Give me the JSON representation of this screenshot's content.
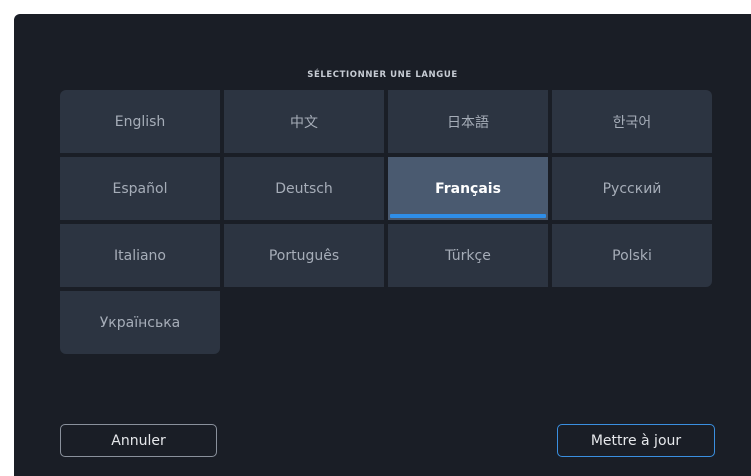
{
  "dialog": {
    "title": "SÉLECTIONNER UNE LANGUE",
    "languages": [
      "English",
      "中文",
      "日本語",
      "한국어",
      "Español",
      "Deutsch",
      "Français",
      "Русский",
      "Italiano",
      "Português",
      "Türkçe",
      "Polski",
      "Українська"
    ],
    "selected_language": "Français",
    "cancel_label": "Annuler",
    "update_label": "Mettre à jour"
  },
  "colors": {
    "background": "#1a1e26",
    "tile": "#2c3441",
    "tile_selected": "#4a5a70",
    "accent": "#2f8ee8"
  }
}
